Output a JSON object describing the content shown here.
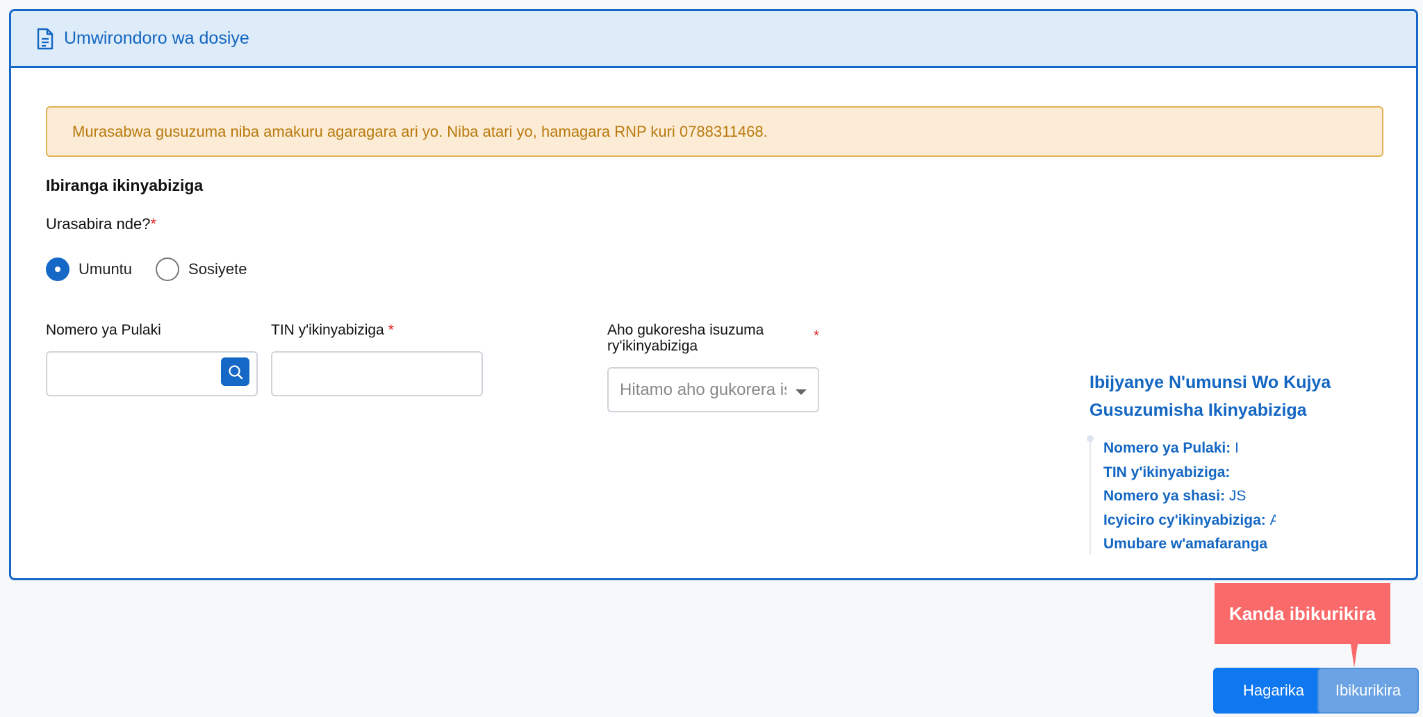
{
  "header": {
    "title": "Umwirondoro wa dosiye",
    "icon": "document-icon"
  },
  "alert": {
    "text": "Murasabwa gusuzuma niba amakuru agaragara ari yo. Niba atari yo, hamagara RNP kuri 0788311468."
  },
  "form": {
    "section_title": "Ibiranga ikinyabiziga",
    "question": "Urasabira nde?",
    "required_mark": "*",
    "options": [
      {
        "label": "Umuntu",
        "selected": true
      },
      {
        "label": "Sosiyete",
        "selected": false
      }
    ],
    "plate": {
      "label": "Nomero ya Pulaki",
      "value": ""
    },
    "tin": {
      "label": "TIN y'ikinyabiziga",
      "value": ""
    },
    "location": {
      "label": "Aho gukoresha isuzuma ry'ikinyabiziga",
      "placeholder": "Hitamo aho gukorera isuzuma"
    }
  },
  "info": {
    "title": "Ibijyanye N'umunsi Wo Kujya Gusuzumisha Ikinyabiziga",
    "rows": [
      {
        "label": "Nomero ya Pulaki:",
        "value": "I"
      },
      {
        "label": "TIN y'ikinyabiziga:",
        "value": ""
      },
      {
        "label": "Nomero ya shasi:",
        "value": "JS"
      },
      {
        "label": "Icyiciro cy'ikinyabiziga:",
        "value": "A"
      },
      {
        "label": "Umubare w'amafaranga",
        "value": ""
      }
    ]
  },
  "tooltip": {
    "text": "Kanda ibikurikira"
  },
  "buttons": {
    "cancel": "Hagarika",
    "next": "Ibikurikira"
  },
  "colors": {
    "primary": "#1568c6",
    "alert_bg": "#fdecd5",
    "alert_text": "#b87a0f",
    "tooltip": "#fb6a6a"
  }
}
